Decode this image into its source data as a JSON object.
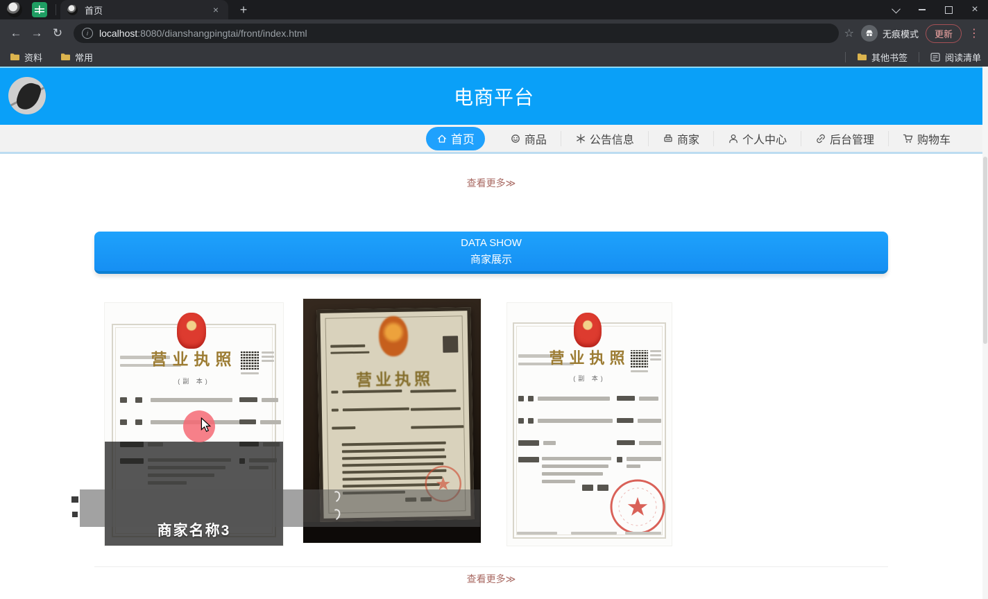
{
  "browser": {
    "tab_title": "首页",
    "url_host": "localhost",
    "url_path": ":8080/dianshangpingtai/front/index.html",
    "incognito_label": "无痕模式",
    "update_label": "更新",
    "bookmarks_left": [
      "资料",
      "常用"
    ],
    "other_bookmarks_label": "其他书签",
    "reading_list_label": "阅读清单",
    "icons": {
      "back": "←",
      "forward": "→",
      "reload": "↻",
      "star": "☆",
      "menu": "⋮",
      "new_tab": "+",
      "close": "×",
      "info": "i"
    }
  },
  "page": {
    "header_title": "电商平台",
    "nav": [
      {
        "label": "首页",
        "icon": "home-icon",
        "active": true
      },
      {
        "label": "商品",
        "icon": "goods-icon"
      },
      {
        "label": "公告信息",
        "icon": "notice-icon"
      },
      {
        "label": "商家",
        "icon": "shop-icon"
      },
      {
        "label": "个人中心",
        "icon": "user-icon"
      },
      {
        "label": "后台管理",
        "icon": "admin-icon"
      },
      {
        "label": "购物车",
        "icon": "cart-icon"
      }
    ],
    "view_more_top": "查看更多≫",
    "banner_title": "DATA SHOW",
    "banner_subtitle": "商家展示",
    "license_title": "营业执照",
    "license_subtitle": "(副 本)",
    "merchant_caption": "商家名称3",
    "view_more_bottom": "查看更多≫",
    "colors": {
      "header_blue": "#0aa0f8",
      "nav_active_blue": "#1fa1fd",
      "banner_blue": "#1a99f8",
      "link_red": "#a96a63",
      "license_gold": "#9c7c33",
      "seal_red": "#cf3a30"
    }
  }
}
